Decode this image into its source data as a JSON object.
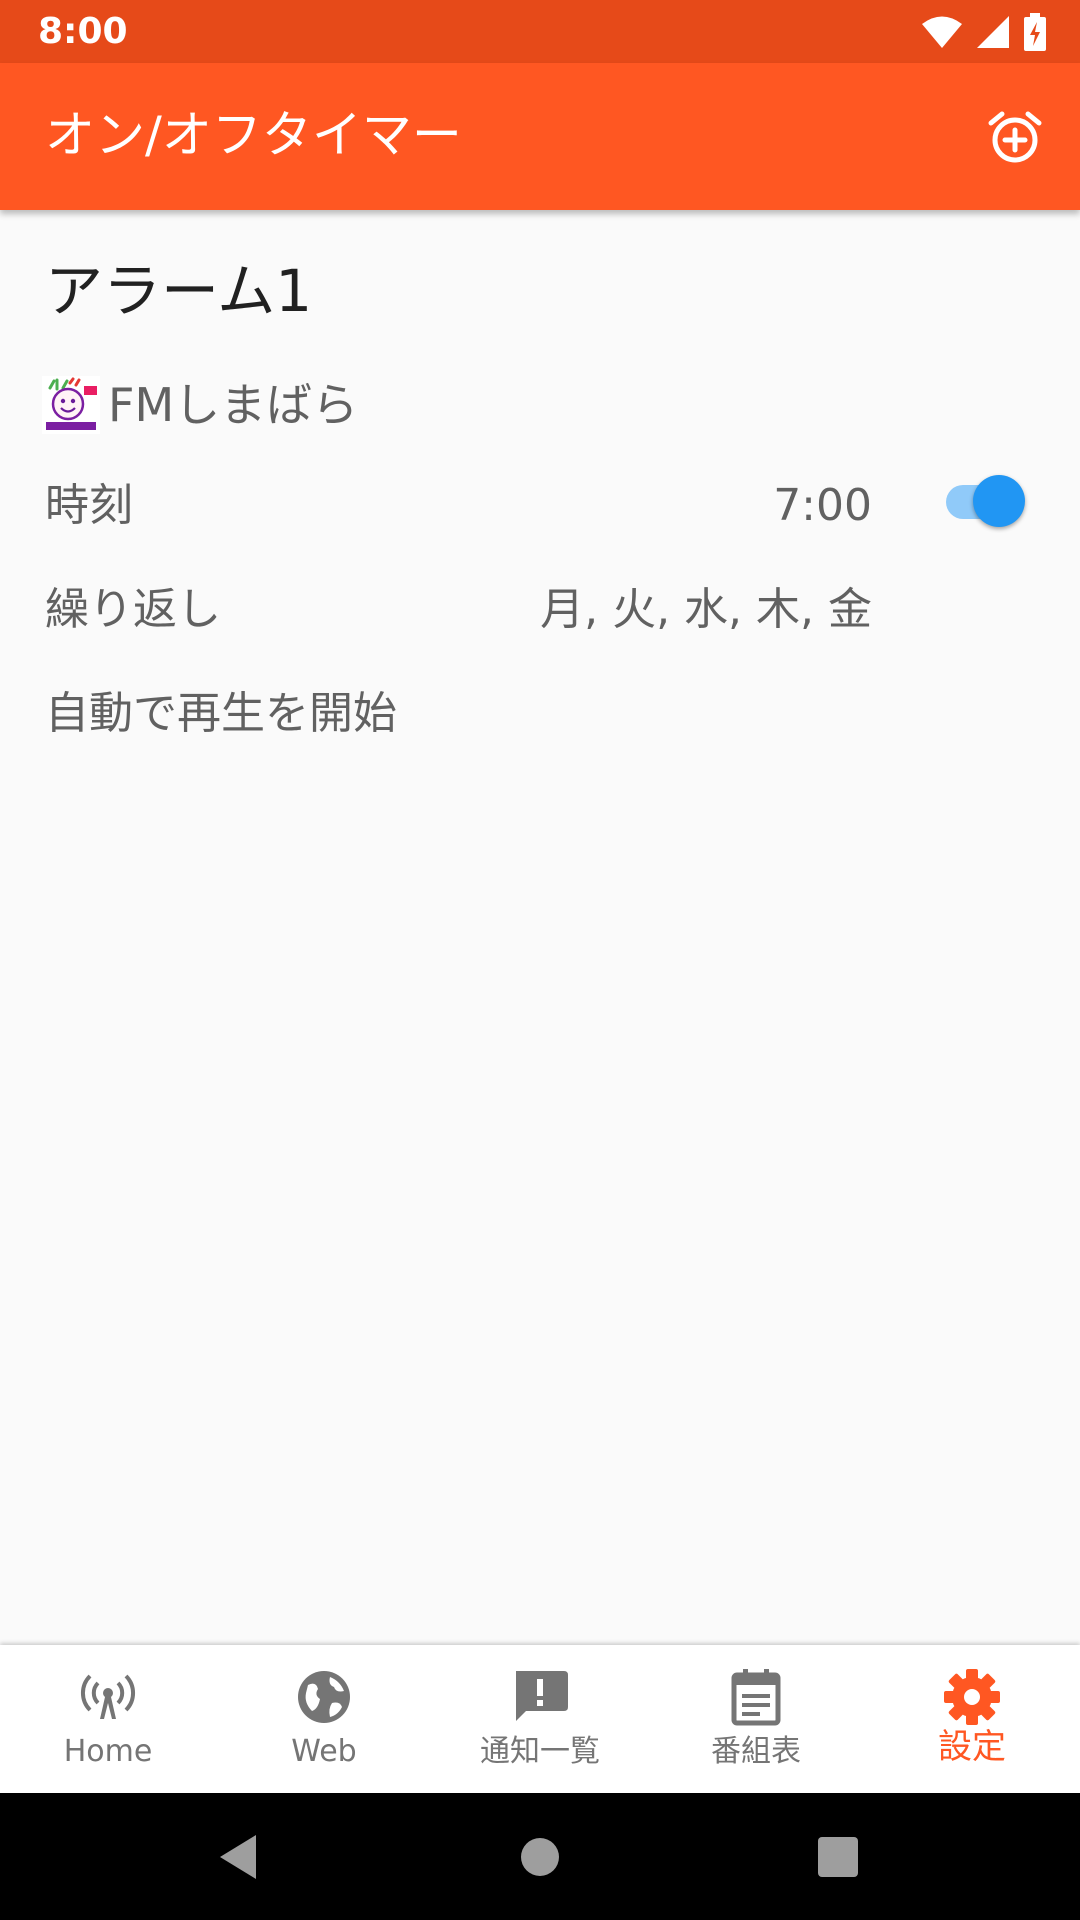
{
  "status_bar": {
    "time": "8:00",
    "icons": [
      "wifi-icon",
      "cellular-signal-icon",
      "battery-charging-icon"
    ]
  },
  "app_bar": {
    "title": "オン/オフタイマー",
    "action_icon": "alarm-add-icon"
  },
  "alarm": {
    "title": "アラーム1",
    "station": {
      "name": "FMしまばら",
      "logo_icon": "station-logo-icon"
    },
    "time_label": "時刻",
    "time_value": "7:00",
    "enabled": true,
    "repeat_label": "繰り返し",
    "repeat_value": "月, 火, 水, 木, 金",
    "autoplay_label": "自動で再生を開始"
  },
  "bottom_nav": {
    "items": [
      {
        "label": "Home",
        "icon": "radio-tower-icon",
        "active": false
      },
      {
        "label": "Web",
        "icon": "globe-icon",
        "active": false
      },
      {
        "label": "通知一覧",
        "icon": "notification-alert-icon",
        "active": false
      },
      {
        "label": "番組表",
        "icon": "calendar-icon",
        "active": false
      },
      {
        "label": "設定",
        "icon": "gear-icon",
        "active": true
      }
    ]
  },
  "colors": {
    "status_bar": "#e64a19",
    "primary": "#ff5722",
    "toggle_thumb": "#2196f3",
    "toggle_track": "#90caf9",
    "text_secondary": "#616161",
    "nav_inactive": "#757575"
  },
  "system_nav": {
    "icons": [
      "back-icon",
      "home-circle-icon",
      "recents-square-icon"
    ]
  }
}
